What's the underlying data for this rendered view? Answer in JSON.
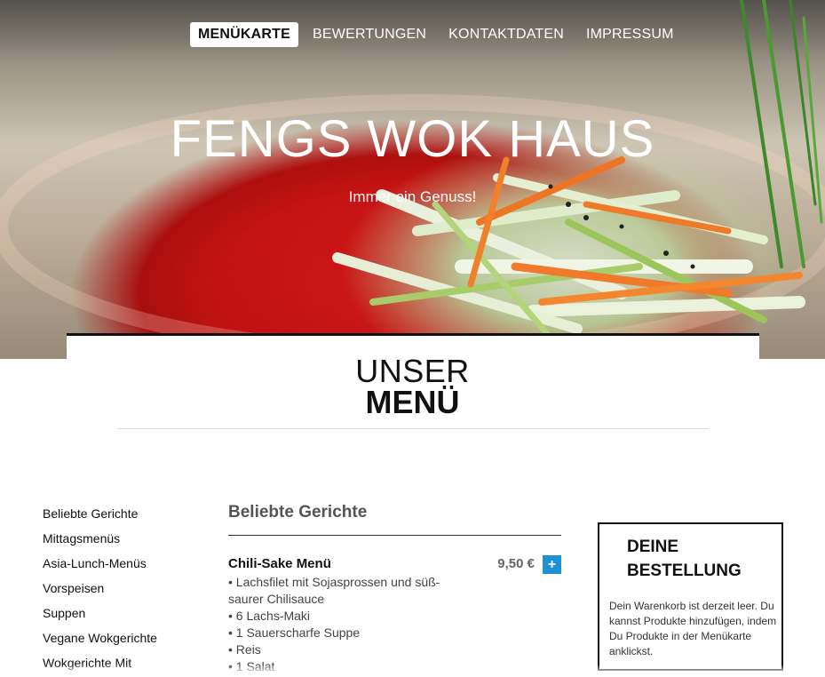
{
  "nav": {
    "items": [
      {
        "label": "MENÜKARTE",
        "active": true
      },
      {
        "label": "BEWERTUNGEN",
        "active": false
      },
      {
        "label": "KONTAKTDATEN",
        "active": false
      },
      {
        "label": "IMPRESSUM",
        "active": false
      }
    ]
  },
  "hero": {
    "title": "FENGS WOK HAUS",
    "subtitle": "Immer ein Genuss!"
  },
  "menu_section": {
    "heading_line1": "UNSER",
    "heading_line2": "MENÜ"
  },
  "sidebar": {
    "items": [
      {
        "label": "Beliebte Gerichte"
      },
      {
        "label": "Mittagsmenüs"
      },
      {
        "label": "Asia-Lunch-Menüs"
      },
      {
        "label": "Vorspeisen"
      },
      {
        "label": "Suppen"
      },
      {
        "label": "Vegane Wokgerichte"
      },
      {
        "label": "Wokgerichte Mit"
      }
    ]
  },
  "category": {
    "title": "Beliebte Gerichte"
  },
  "dishes": [
    {
      "name": "Chili-Sake Menü",
      "price": "9,50 €",
      "add_label": "+",
      "description_lines": [
        "• Lachsfilet mit Sojasprossen und süß-",
        "saurer Chilisauce",
        "• 6 Lachs-Maki",
        "• 1 Sauerscharfe Suppe",
        "• Reis",
        "• 1 Salat"
      ]
    }
  ],
  "order": {
    "title": "DEINE BESTELLUNG",
    "empty_text": "Dein Warenkorb ist derzeit leer. Du kannst Produkte hinzufügen, indem Du Produkte in der Menükarte anklickst."
  },
  "colors": {
    "accent": "#1e90d6",
    "hero_red": "#d31414",
    "text_dark": "#111111"
  }
}
